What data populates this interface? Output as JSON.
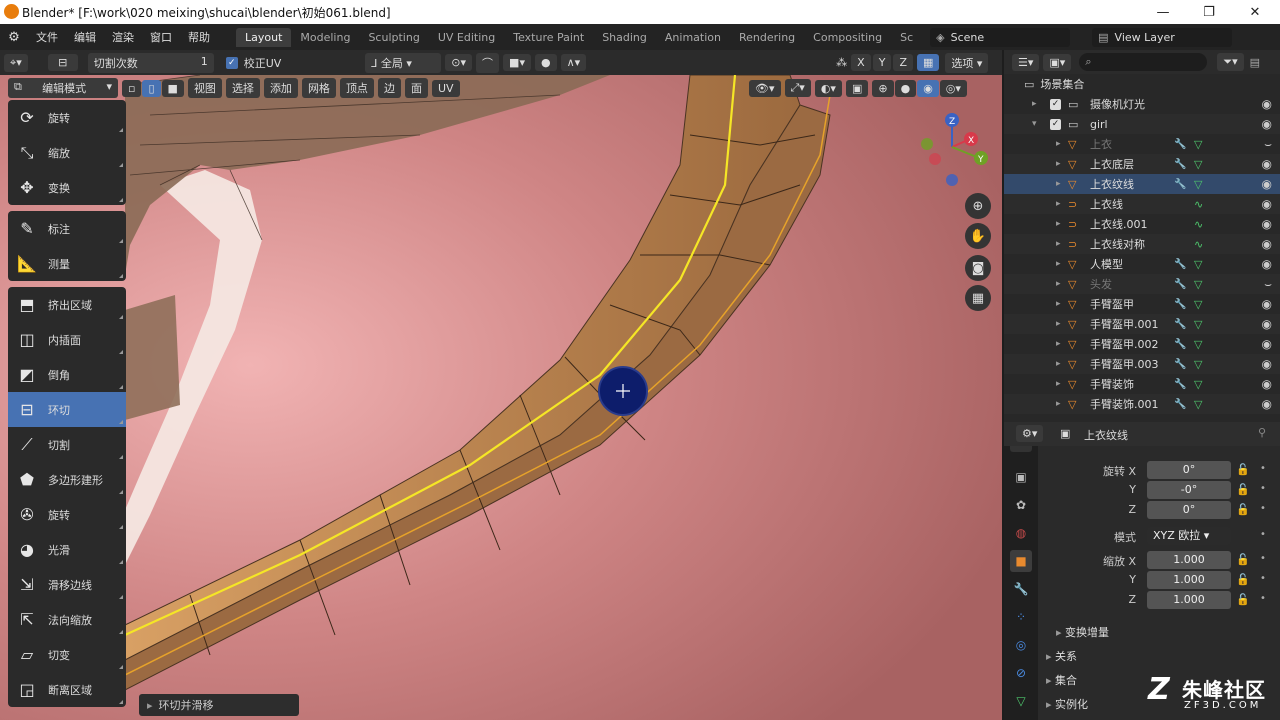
{
  "window": {
    "title": "Blender* [F:\\work\\020 meixing\\shucai\\blender\\初始061.blend]"
  },
  "menu": [
    "文件",
    "编辑",
    "渲染",
    "窗口",
    "帮助"
  ],
  "workspaces": [
    "Layout",
    "Modeling",
    "Sculpting",
    "UV Editing",
    "Texture Paint",
    "Shading",
    "Animation",
    "Rendering",
    "Compositing",
    "Sc"
  ],
  "active_workspace": "Layout",
  "scene": "Scene",
  "view_layer": "View Layer",
  "tool_settings": {
    "cut_label": "切割次数",
    "cut_value": "1",
    "correct_uv": "校正UV",
    "transform_orientation": "全局",
    "options": "选项"
  },
  "axes": [
    "X",
    "Y",
    "Z"
  ],
  "mode": "编辑模式",
  "view_menus": [
    "视图",
    "选择",
    "添加",
    "网格",
    "顶点",
    "边",
    "面",
    "UV"
  ],
  "tools": [
    {
      "label": "旋转",
      "icon": "rotate-icon"
    },
    {
      "label": "缩放",
      "icon": "scale-icon"
    },
    {
      "label": "变换",
      "icon": "transform-icon"
    },
    {
      "label": "标注",
      "icon": "annotate-icon"
    },
    {
      "label": "测量",
      "icon": "measure-icon"
    },
    {
      "label": "挤出区域",
      "icon": "extrude-icon"
    },
    {
      "label": "内插面",
      "icon": "inset-icon"
    },
    {
      "label": "倒角",
      "icon": "bevel-icon"
    },
    {
      "label": "环切",
      "icon": "loopcut-icon"
    },
    {
      "label": "切割",
      "icon": "knife-icon"
    },
    {
      "label": "多边形建形",
      "icon": "polybuild-icon"
    },
    {
      "label": "旋转",
      "icon": "spin-icon"
    },
    {
      "label": "光滑",
      "icon": "smooth-icon"
    },
    {
      "label": "滑移边线",
      "icon": "edge-slide-icon"
    },
    {
      "label": "法向缩放",
      "icon": "shrink-fatten-icon"
    },
    {
      "label": "切变",
      "icon": "shear-icon"
    },
    {
      "label": "断离区域",
      "icon": "rip-region-icon"
    }
  ],
  "active_tool": "环切",
  "last_operator": "环切并滑移",
  "outliner": {
    "root": "场景集合",
    "items": [
      {
        "name": "摄像机灯光",
        "depth": 0,
        "type": "collection"
      },
      {
        "name": "girl",
        "depth": 0,
        "type": "collection"
      },
      {
        "name": "上衣",
        "depth": 1,
        "type": "mesh",
        "dim": true
      },
      {
        "name": "上衣底层",
        "depth": 1,
        "type": "mesh"
      },
      {
        "name": "上衣纹线",
        "depth": 1,
        "type": "mesh",
        "selected": true
      },
      {
        "name": "上衣线",
        "depth": 1,
        "type": "curve"
      },
      {
        "name": "上衣线.001",
        "depth": 1,
        "type": "curve"
      },
      {
        "name": "上衣线对称",
        "depth": 1,
        "type": "curve"
      },
      {
        "name": "人模型",
        "depth": 1,
        "type": "mesh"
      },
      {
        "name": "头发",
        "depth": 1,
        "type": "mesh",
        "dim": true
      },
      {
        "name": "手臂盔甲",
        "depth": 1,
        "type": "mesh"
      },
      {
        "name": "手臂盔甲.001",
        "depth": 1,
        "type": "mesh"
      },
      {
        "name": "手臂盔甲.002",
        "depth": 1,
        "type": "mesh"
      },
      {
        "name": "手臂盔甲.003",
        "depth": 1,
        "type": "mesh"
      },
      {
        "name": "手臂装饰",
        "depth": 1,
        "type": "mesh"
      },
      {
        "name": "手臂装饰.001",
        "depth": 1,
        "type": "mesh"
      }
    ]
  },
  "properties": {
    "object_name": "上衣纹线",
    "rotation_label": "旋转",
    "rotation": [
      {
        "axis": "X",
        "value": "0°"
      },
      {
        "axis": "Y",
        "value": "-0°"
      },
      {
        "axis": "Z",
        "value": "0°"
      }
    ],
    "mode_label": "模式",
    "mode_value": "XYZ 欧拉",
    "scale_label": "缩放",
    "scale": [
      {
        "axis": "X",
        "value": "1.000"
      },
      {
        "axis": "Y",
        "value": "1.000"
      },
      {
        "axis": "Z",
        "value": "1.000"
      }
    ],
    "panels": [
      "变换增量",
      "关系",
      "集合",
      "实例化"
    ]
  },
  "watermark": {
    "brand": "朱峰社区",
    "url": "ZF3D.COM"
  },
  "colors": {
    "accent": "#4772b3",
    "mesh": "#c8894a",
    "highlight": "#f5e626",
    "background": "#b76b6b"
  }
}
